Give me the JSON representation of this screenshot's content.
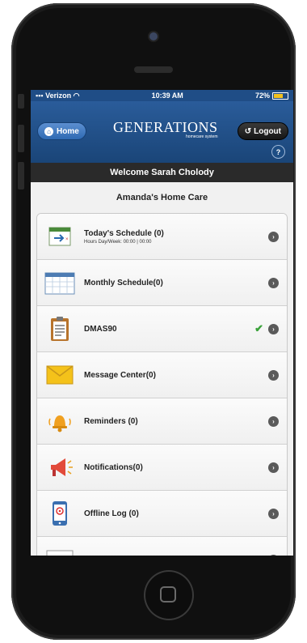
{
  "status_bar": {
    "carrier": "Verizon",
    "time": "10:39 AM",
    "battery": "72%"
  },
  "header": {
    "home_label": "Home",
    "logo_text": "GENERATIONS",
    "logo_tagline": "homecare system",
    "logout_label": "Logout",
    "help_label": "?"
  },
  "welcome": "Welcome Sarah Cholody",
  "agency": "Amanda's Home Care",
  "menu": [
    {
      "label": "Today's Schedule (0)",
      "sub": "Hours Day/Week: 00:00 | 00:00",
      "icon": "schedule-arrow-icon"
    },
    {
      "label": "Monthly Schedule(0)",
      "icon": "calendar-icon"
    },
    {
      "label": "DMAS90",
      "icon": "clipboard-icon",
      "checked": true
    },
    {
      "label": "Message Center(0)",
      "icon": "envelope-icon"
    },
    {
      "label": "Reminders (0)",
      "icon": "bell-icon"
    },
    {
      "label": "Notifications(0)",
      "icon": "megaphone-icon"
    },
    {
      "label": "Offline Log (0)",
      "icon": "mobile-signal-icon"
    }
  ],
  "colors": {
    "header": "#1f4d86",
    "welcome_bar": "#2a2a2a",
    "check": "#3aa23a"
  }
}
